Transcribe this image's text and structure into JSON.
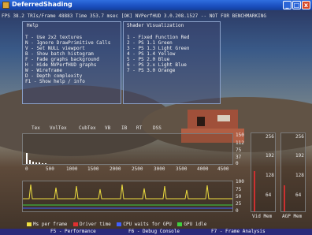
{
  "window": {
    "title": "DeferredShading",
    "buttons": {
      "minimize": "_",
      "maximize": "□",
      "close": "x"
    }
  },
  "statusline": "FPS  38.2  TRIs/Frame    48883  Time  353.7 msec [OK] NVPerfHUD 3.0.208.1527 -- NOT FOR BENCHMARKING",
  "help": {
    "header": "Help",
    "items": [
      "T   - Use 2x2 textures",
      "N   - Ignore DrawPrimitive Calls",
      "V   - Set NULL viewport",
      "B   - Show batch histogram",
      "F   - Fade graphs background",
      "H   - Hide NVPerfHUD graphs",
      "W   - Wireframe",
      "D   - Depth complexity",
      "F1  - Show help / info"
    ]
  },
  "shader_viz": {
    "header": "Shader Visualization",
    "items": [
      "1 - Fixed Function Red",
      "2 - PS 1.1 Green",
      "3 - PS 1.3 Light Green",
      "4 - PS 1.4 Yellow",
      "5 - PS 2.0 Blue",
      "6 - PS 2.x Light Blue",
      "7 - PS 3.0 Orange"
    ]
  },
  "columns": [
    "Tex",
    "VolTex",
    "CubTex",
    "VB",
    "IB",
    "RT",
    "DSS"
  ],
  "histogram": {
    "x_labels": [
      "0",
      "500",
      "1000",
      "1500",
      "2000",
      "2500",
      "3000",
      "3500",
      "4000",
      "4500"
    ],
    "y_labels": [
      "150",
      "112",
      "75",
      "37",
      "0"
    ],
    "counts": [
      55,
      20,
      12,
      8,
      6,
      5,
      3
    ]
  },
  "timing_graph": {
    "y_labels": [
      "100",
      "75",
      "50",
      "25",
      "0"
    ]
  },
  "memory": {
    "vid_label": "Vid Mem",
    "agp_label": "AGP Mem",
    "scale": [
      "256",
      "192",
      "128",
      "64"
    ],
    "vid_used_fraction": 0.52,
    "agp_used_fraction": 0.33
  },
  "legend": [
    {
      "label": "Ms per frame",
      "color": "#f0e040"
    },
    {
      "label": "Driver time",
      "color": "#e03030"
    },
    {
      "label": "CPU waits for GPU",
      "color": "#4060ff"
    },
    {
      "label": "GPU idle",
      "color": "#40d040"
    }
  ],
  "footer": {
    "f5": "F5 - Performance",
    "f6": "F6 - Debug Console",
    "f7": "F7 - Frame Analysis"
  }
}
